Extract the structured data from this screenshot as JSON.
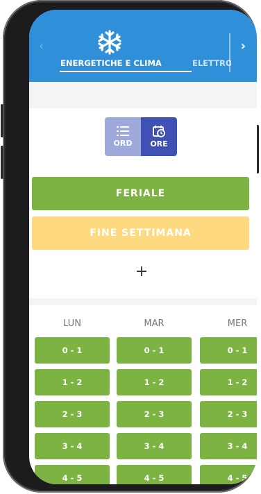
{
  "header": {
    "category_icon": "snowflake-icon",
    "active_tab": "ENERGETICHE E CLIMA",
    "next_tab": "ELETTRO",
    "prev_icon": "chevron-left-icon",
    "next_icon": "chevron-right-icon",
    "color": "#2f8fd9"
  },
  "view_toggle": {
    "options": [
      {
        "label": "ORD",
        "icon": "list-icon",
        "active": false
      },
      {
        "label": "ORE",
        "icon": "calendar-clock-icon",
        "active": true
      }
    ]
  },
  "programs": [
    {
      "label": "FERIALE",
      "color": "#7cb342"
    },
    {
      "label": "FINE SETTIMANA",
      "color": "#ffd97f"
    }
  ],
  "add_label": "+",
  "days": [
    "LUN",
    "MAR",
    "MER"
  ],
  "slots": [
    "0 - 1",
    "1 - 2",
    "2 - 3",
    "3 - 4",
    "4 - 5"
  ],
  "slot_color": "#7cb342"
}
